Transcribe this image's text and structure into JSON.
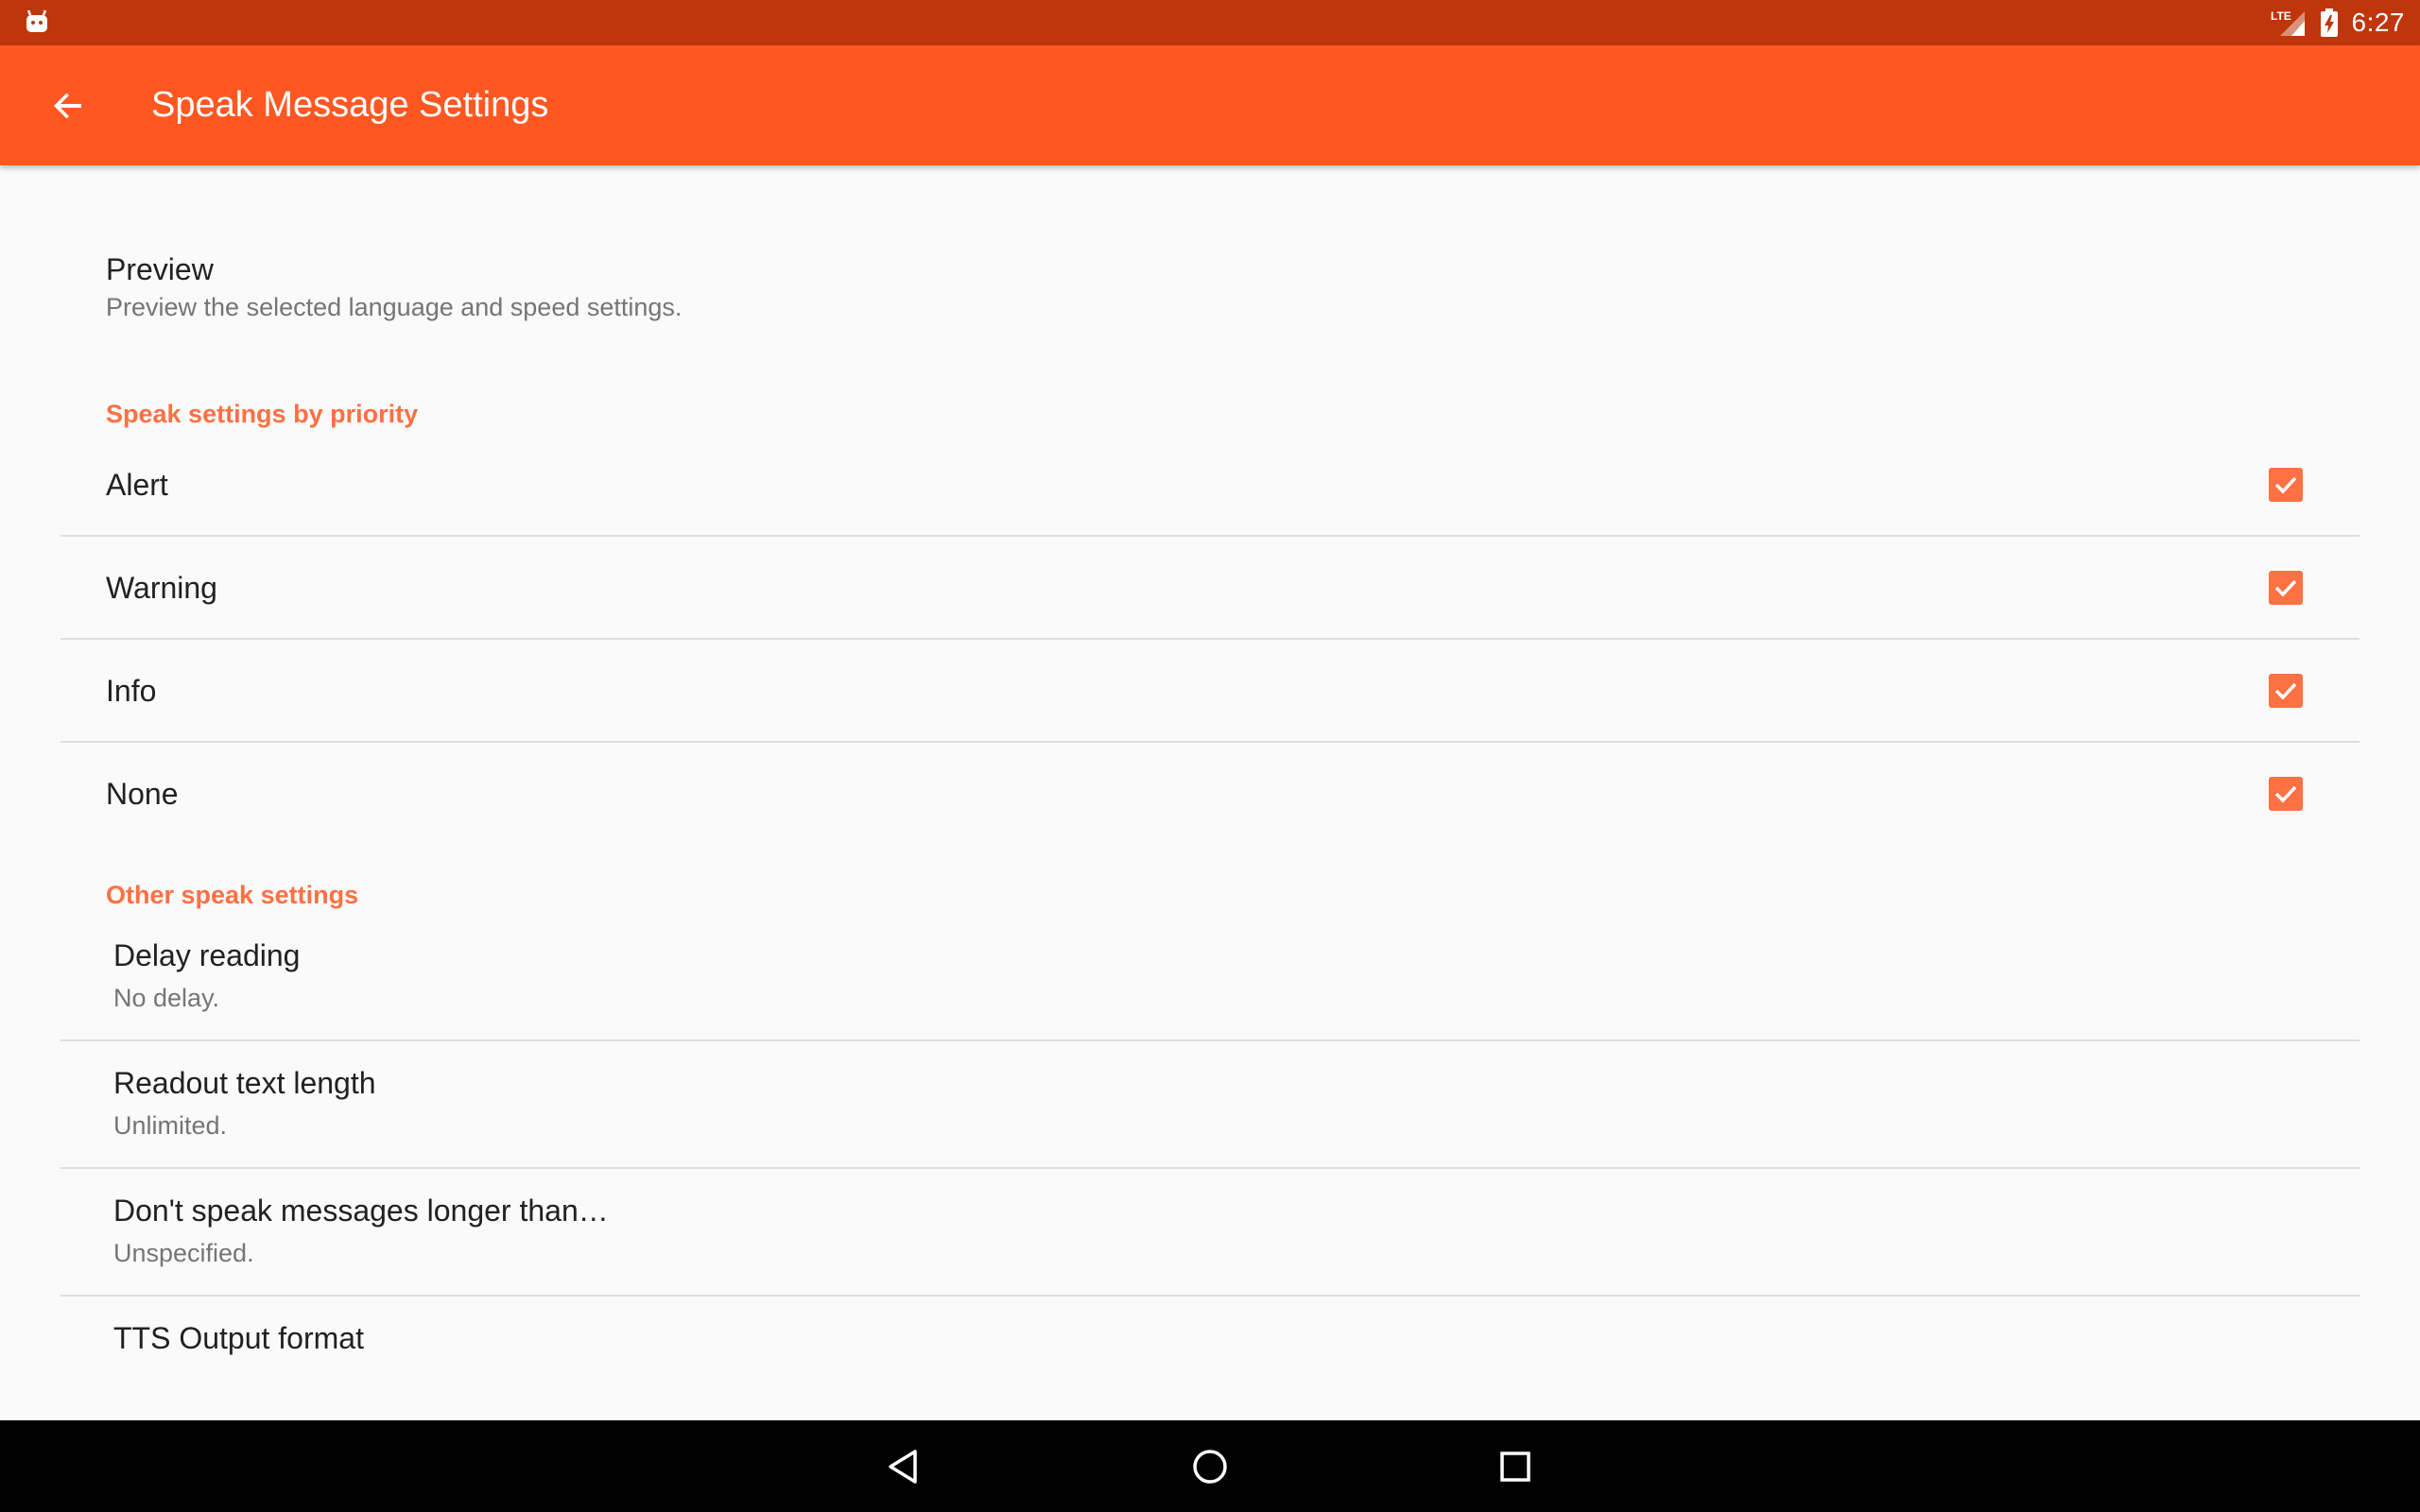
{
  "status_bar": {
    "app_icon": "android-notification-icon",
    "network_label": "LTE",
    "signal_icon": "cell-signal-icon",
    "battery_icon": "battery-charging-icon",
    "time": "6:27",
    "color": "#bf360c"
  },
  "toolbar": {
    "back_icon": "arrow-back-icon",
    "title": "Speak Message Settings",
    "color": "#ff5722"
  },
  "preview": {
    "title": "Preview",
    "summary": "Preview the selected language and speed settings."
  },
  "priority_section": {
    "header": "Speak settings by priority",
    "items": [
      {
        "label": "Alert",
        "checked": true
      },
      {
        "label": "Warning",
        "checked": true
      },
      {
        "label": "Info",
        "checked": true
      },
      {
        "label": "None",
        "checked": true
      }
    ]
  },
  "other_section": {
    "header": "Other speak settings",
    "items": [
      {
        "title": "Delay reading",
        "summary": "No delay."
      },
      {
        "title": "Readout text length",
        "summary": "Unlimited."
      },
      {
        "title": "Don't speak messages longer than…",
        "summary": "Unspecified."
      },
      {
        "title": "TTS Output format",
        "summary": ""
      }
    ]
  },
  "nav_bar": {
    "back_icon": "nav-back-triangle-icon",
    "home_icon": "nav-home-circle-icon",
    "recents_icon": "nav-recents-square-icon"
  },
  "accent_color": "#ff7043"
}
